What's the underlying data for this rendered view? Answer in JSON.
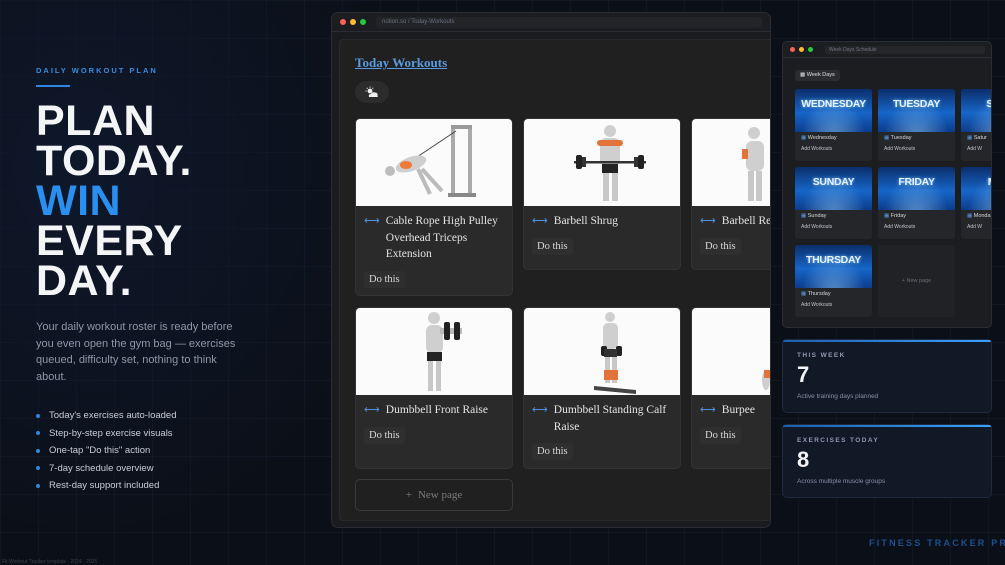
{
  "hero": {
    "eyebrow": "DAILY WORKOUT PLAN",
    "headline": [
      "PLAN",
      "TODAY.",
      "WIN",
      "EVERY",
      "DAY."
    ],
    "description": "Your daily workout roster is ready before you even open the gym bag — exercises queued, difficulty set, nothing to think about.",
    "bullets": [
      "Today's exercises auto-loaded",
      "Step-by-step exercise visuals",
      "One-tap \"Do this\" action",
      "7-day schedule overview",
      "Rest-day support included"
    ]
  },
  "main_window": {
    "url": "notion.so / Today-Workouts",
    "page_title": "Today Workouts",
    "weather_icon": "sun-cloud-icon",
    "cards": [
      {
        "name": "Cable Rope High Pulley Overhead Triceps Extension",
        "action": "Do this"
      },
      {
        "name": "Barbell Shrug",
        "action": "Do this"
      },
      {
        "name": "Barbell Rear",
        "action": "Do this"
      },
      {
        "name": "Dumbbell Front Raise",
        "action": "Do this"
      },
      {
        "name": "Dumbbell Standing Calf Raise",
        "action": "Do this"
      },
      {
        "name": "Burpee",
        "action": "Do this"
      }
    ],
    "new_page": "New page"
  },
  "schedule_window": {
    "url": "Week Days Schedule",
    "tag": "Week Days",
    "days": [
      {
        "banner": "WEDNESDAY",
        "name": "Wednesday",
        "action": "Add Workouts"
      },
      {
        "banner": "TUESDAY",
        "name": "Tuesday",
        "action": "Add Workouts"
      },
      {
        "banner": "SATU",
        "name": "Satur",
        "action": "Add W"
      },
      {
        "banner": "SUNDAY",
        "name": "Sunday",
        "action": "Add Workouts"
      },
      {
        "banner": "FRIDAY",
        "name": "Friday",
        "action": "Add Workouts"
      },
      {
        "banner": "MON",
        "name": "Monda",
        "action": "Add W"
      },
      {
        "banner": "THURSDAY",
        "name": "Thursday",
        "action": "Add Workouts"
      }
    ],
    "new_page": "+ New page"
  },
  "stats": [
    {
      "label": "THIS WEEK",
      "value": "7",
      "sub": "Active training days planned"
    },
    {
      "label": "EXERCISES TODAY",
      "value": "8",
      "sub": "Across multiple muscle groups"
    }
  ],
  "brand": "FITNESS TRACKER PRO",
  "footer": "Fit Workout Tracker template · 2024 · 2025",
  "colors": {
    "accent": "#2b8fef",
    "link": "#5b9be0",
    "background": "#0b0f17"
  }
}
